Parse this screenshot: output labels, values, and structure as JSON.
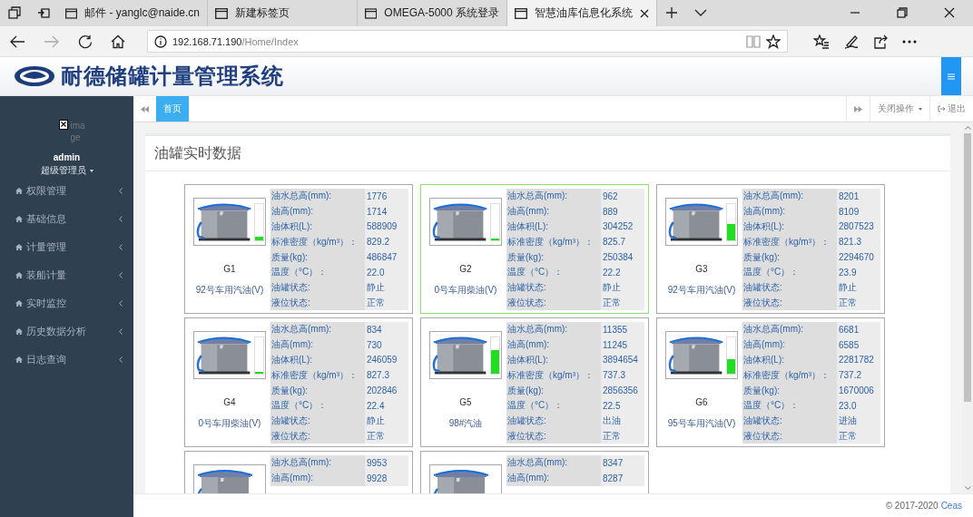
{
  "browser": {
    "tabs": [
      {
        "title": "邮件 - yanglc@naide.cn",
        "selected": false
      },
      {
        "title": "新建标签页",
        "selected": false
      },
      {
        "title": "OMEGA-5000 系统登录",
        "selected": false
      },
      {
        "title": "智慧油库信息化系统",
        "selected": true
      }
    ],
    "address": {
      "host": "192.168.71.190",
      "path": "/Home/Index"
    }
  },
  "app": {
    "title": "耐德储罐计量管理系统",
    "user": {
      "avatar_alt": "image",
      "name": "admin",
      "role": "超级管理员"
    },
    "menu": [
      {
        "label": "权限管理"
      },
      {
        "label": "基础信息"
      },
      {
        "label": "计量管理"
      },
      {
        "label": "装船计量"
      },
      {
        "label": "实时监控"
      },
      {
        "label": "历史数据分析"
      },
      {
        "label": "日志查询"
      }
    ],
    "page_tabs": [
      {
        "label": "首页",
        "selected": true
      }
    ],
    "toolbar": {
      "close_menu": "关闭操作",
      "logout": "退出"
    },
    "panel_title": "油罐实时数据",
    "tanks": [
      {
        "name": "G1",
        "product": "92号车用汽油(V)",
        "level": 0.1,
        "selected": false,
        "fields": [
          {
            "label": "油水总高(mm):",
            "value": "1776"
          },
          {
            "label": "油高(mm):",
            "value": "1714"
          },
          {
            "label": "油体积(L):",
            "value": "588909"
          },
          {
            "label": "标准密度（kg/m³）：",
            "value": "829.2"
          },
          {
            "label": "质量(kg):",
            "value": "486847"
          },
          {
            "label": "温度（°C）：",
            "value": "22.0"
          },
          {
            "label": "油罐状态:",
            "value": "静止"
          },
          {
            "label": "液位状态:",
            "value": "正常"
          }
        ]
      },
      {
        "name": "G2",
        "product": "0号车用柴油(V)",
        "level": 0.05,
        "selected": true,
        "fields": [
          {
            "label": "油水总高(mm):",
            "value": "962"
          },
          {
            "label": "油高(mm):",
            "value": "889"
          },
          {
            "label": "油体积(L):",
            "value": "304252"
          },
          {
            "label": "标准密度（kg/m³）：",
            "value": "825.7"
          },
          {
            "label": "质量(kg):",
            "value": "250384"
          },
          {
            "label": "温度（°C）：",
            "value": "22.2"
          },
          {
            "label": "油罐状态:",
            "value": "静止"
          },
          {
            "label": "液位状态:",
            "value": "正常"
          }
        ]
      },
      {
        "name": "G3",
        "product": "92号车用汽油(V)",
        "level": 0.45,
        "selected": false,
        "fields": [
          {
            "label": "油水总高(mm):",
            "value": "8201"
          },
          {
            "label": "油高(mm):",
            "value": "8109"
          },
          {
            "label": "油体积(L):",
            "value": "2807523"
          },
          {
            "label": "标准密度（kg/m³）：",
            "value": "821.3"
          },
          {
            "label": "质量(kg):",
            "value": "2294670"
          },
          {
            "label": "温度（°C）：",
            "value": "23.9"
          },
          {
            "label": "油罐状态:",
            "value": "静止"
          },
          {
            "label": "液位状态:",
            "value": "正常"
          }
        ]
      },
      {
        "name": "G4",
        "product": "0号车用柴油(V)",
        "level": 0.05,
        "selected": false,
        "fields": [
          {
            "label": "油水总高(mm):",
            "value": "834"
          },
          {
            "label": "油高(mm):",
            "value": "730"
          },
          {
            "label": "油体积(L):",
            "value": "246059"
          },
          {
            "label": "标准密度（kg/m³）：",
            "value": "827.3"
          },
          {
            "label": "质量(kg):",
            "value": "202846"
          },
          {
            "label": "温度（°C）：",
            "value": "22.4"
          },
          {
            "label": "油罐状态:",
            "value": "静止"
          },
          {
            "label": "液位状态:",
            "value": "正常"
          }
        ]
      },
      {
        "name": "G5",
        "product": "98#汽油",
        "level": 0.65,
        "selected": false,
        "fields": [
          {
            "label": "油水总高(mm):",
            "value": "11355"
          },
          {
            "label": "油高(mm):",
            "value": "11245"
          },
          {
            "label": "油体积(L):",
            "value": "3894654"
          },
          {
            "label": "标准密度（kg/m³）：",
            "value": "737.3"
          },
          {
            "label": "质量(kg):",
            "value": "2856356"
          },
          {
            "label": "温度（°C）：",
            "value": "22.5"
          },
          {
            "label": "油罐状态:",
            "value": "出油"
          },
          {
            "label": "液位状态:",
            "value": "正常"
          }
        ]
      },
      {
        "name": "G6",
        "product": "95号车用汽油(V)",
        "level": 0.38,
        "selected": false,
        "fields": [
          {
            "label": "油水总高(mm):",
            "value": "6681"
          },
          {
            "label": "油高(mm):",
            "value": "6585"
          },
          {
            "label": "油体积(L):",
            "value": "2281782"
          },
          {
            "label": "标准密度（kg/m³）：",
            "value": "737.2"
          },
          {
            "label": "质量(kg):",
            "value": "1670006"
          },
          {
            "label": "温度（°C）：",
            "value": "23.0"
          },
          {
            "label": "油罐状态:",
            "value": "进油"
          },
          {
            "label": "液位状态:",
            "value": "正常"
          }
        ]
      },
      {
        "selected": false,
        "fields": [
          {
            "label": "油水总高(mm):",
            "value": "9953"
          },
          {
            "label": "油高(mm):",
            "value": "9928"
          }
        ]
      },
      {
        "selected": false,
        "fields": [
          {
            "label": "油水总高(mm):",
            "value": "8347"
          },
          {
            "label": "油高(mm):",
            "value": "8287"
          }
        ]
      }
    ],
    "footer": {
      "copyright": "© 2017-2020",
      "link": "Ceas"
    }
  }
}
